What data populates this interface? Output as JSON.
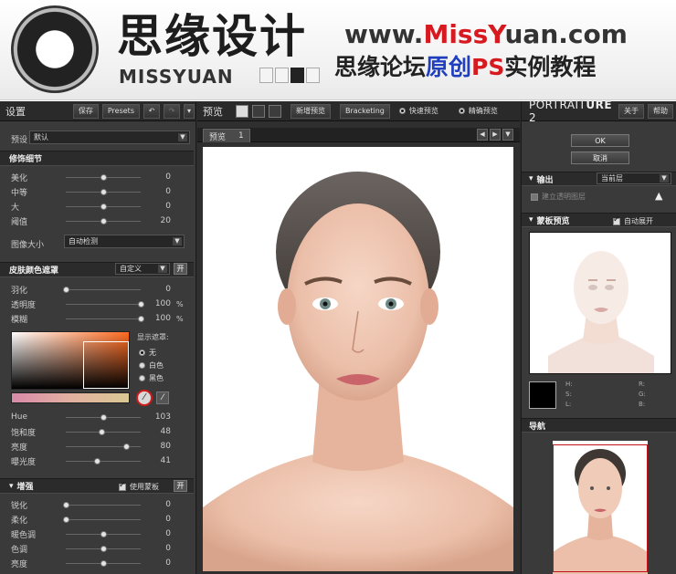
{
  "banner": {
    "brand_cn": "思缘设计",
    "brand_en": "MISSYUAN",
    "url_prefix": "www.",
    "url_miss": "Miss",
    "url_y": "Y",
    "url_rest": "uan.com",
    "slogan_a": "思缘论坛",
    "slogan_b": "原创",
    "slogan_c": "PS",
    "slogan_d": "实例教程"
  },
  "left_panel": {
    "title": "设置",
    "save": "保存",
    "presets": "Presets",
    "preset_label": "预设",
    "preset_value": "默认",
    "detail": {
      "title": "修饰细节",
      "sliders": [
        {
          "label": "美化",
          "value": "0",
          "pos": 0.5
        },
        {
          "label": "中等",
          "value": "0",
          "pos": 0.5
        },
        {
          "label": "大",
          "value": "0",
          "pos": 0.5
        },
        {
          "label": "阈值",
          "value": "20",
          "pos": 0.5
        }
      ],
      "image_size_label": "图像大小",
      "image_size_value": "自动检测"
    },
    "skin_mask": {
      "title": "皮肤颜色遮罩",
      "mode": "自定义",
      "on_btn": "开",
      "sliders": [
        {
          "label": "羽化",
          "value": "0",
          "pos": 0.0,
          "pct": ""
        },
        {
          "label": "透明度",
          "value": "100",
          "pos": 1.0,
          "pct": "%"
        },
        {
          "label": "模糊",
          "value": "100",
          "pos": 1.0,
          "pct": "%"
        }
      ],
      "show_mask_label": "显示遮罩:",
      "show_mask_options": [
        "无",
        "白色",
        "黑色"
      ],
      "hsl_sliders": [
        {
          "label": "Hue",
          "value": "103",
          "pos": 0.5
        },
        {
          "label": "饱和度",
          "value": "48",
          "pos": 0.48
        },
        {
          "label": "亮度",
          "value": "80",
          "pos": 0.8
        },
        {
          "label": "曝光度",
          "value": "41",
          "pos": 0.41
        }
      ]
    },
    "enhance": {
      "title": "增强",
      "use_mask": "使用蒙板",
      "on_btn": "开",
      "sliders": [
        {
          "label": "锐化",
          "value": "0",
          "pos": 0.0
        },
        {
          "label": "柔化",
          "value": "0",
          "pos": 0.0
        },
        {
          "label": "暖色调",
          "value": "0",
          "pos": 0.5
        },
        {
          "label": "色调",
          "value": "0",
          "pos": 0.5
        },
        {
          "label": "亮度",
          "value": "0",
          "pos": 0.5
        }
      ]
    }
  },
  "center_panel": {
    "title": "预览",
    "new_preview": "新增预览",
    "bracketing": "Bracketing",
    "fast_preview": "快速预览",
    "precise_preview": "精确预览",
    "tab_label": "预览",
    "tab_num": "1"
  },
  "right_panel": {
    "title_a": "PORTRAIT",
    "title_b": "URE",
    "title_num": "2",
    "about": "关于",
    "help": "帮助",
    "ok": "OK",
    "cancel": "取消",
    "output_label": "输出",
    "output_value": "当前层",
    "transparency": "建立透明图层",
    "mask_preview": "蒙板预览",
    "auto_expand": "自动展开",
    "h": "H:",
    "s": "S:",
    "l": "L:",
    "r": "R:",
    "g": "G:",
    "b": "B:",
    "navigator": "导航"
  }
}
